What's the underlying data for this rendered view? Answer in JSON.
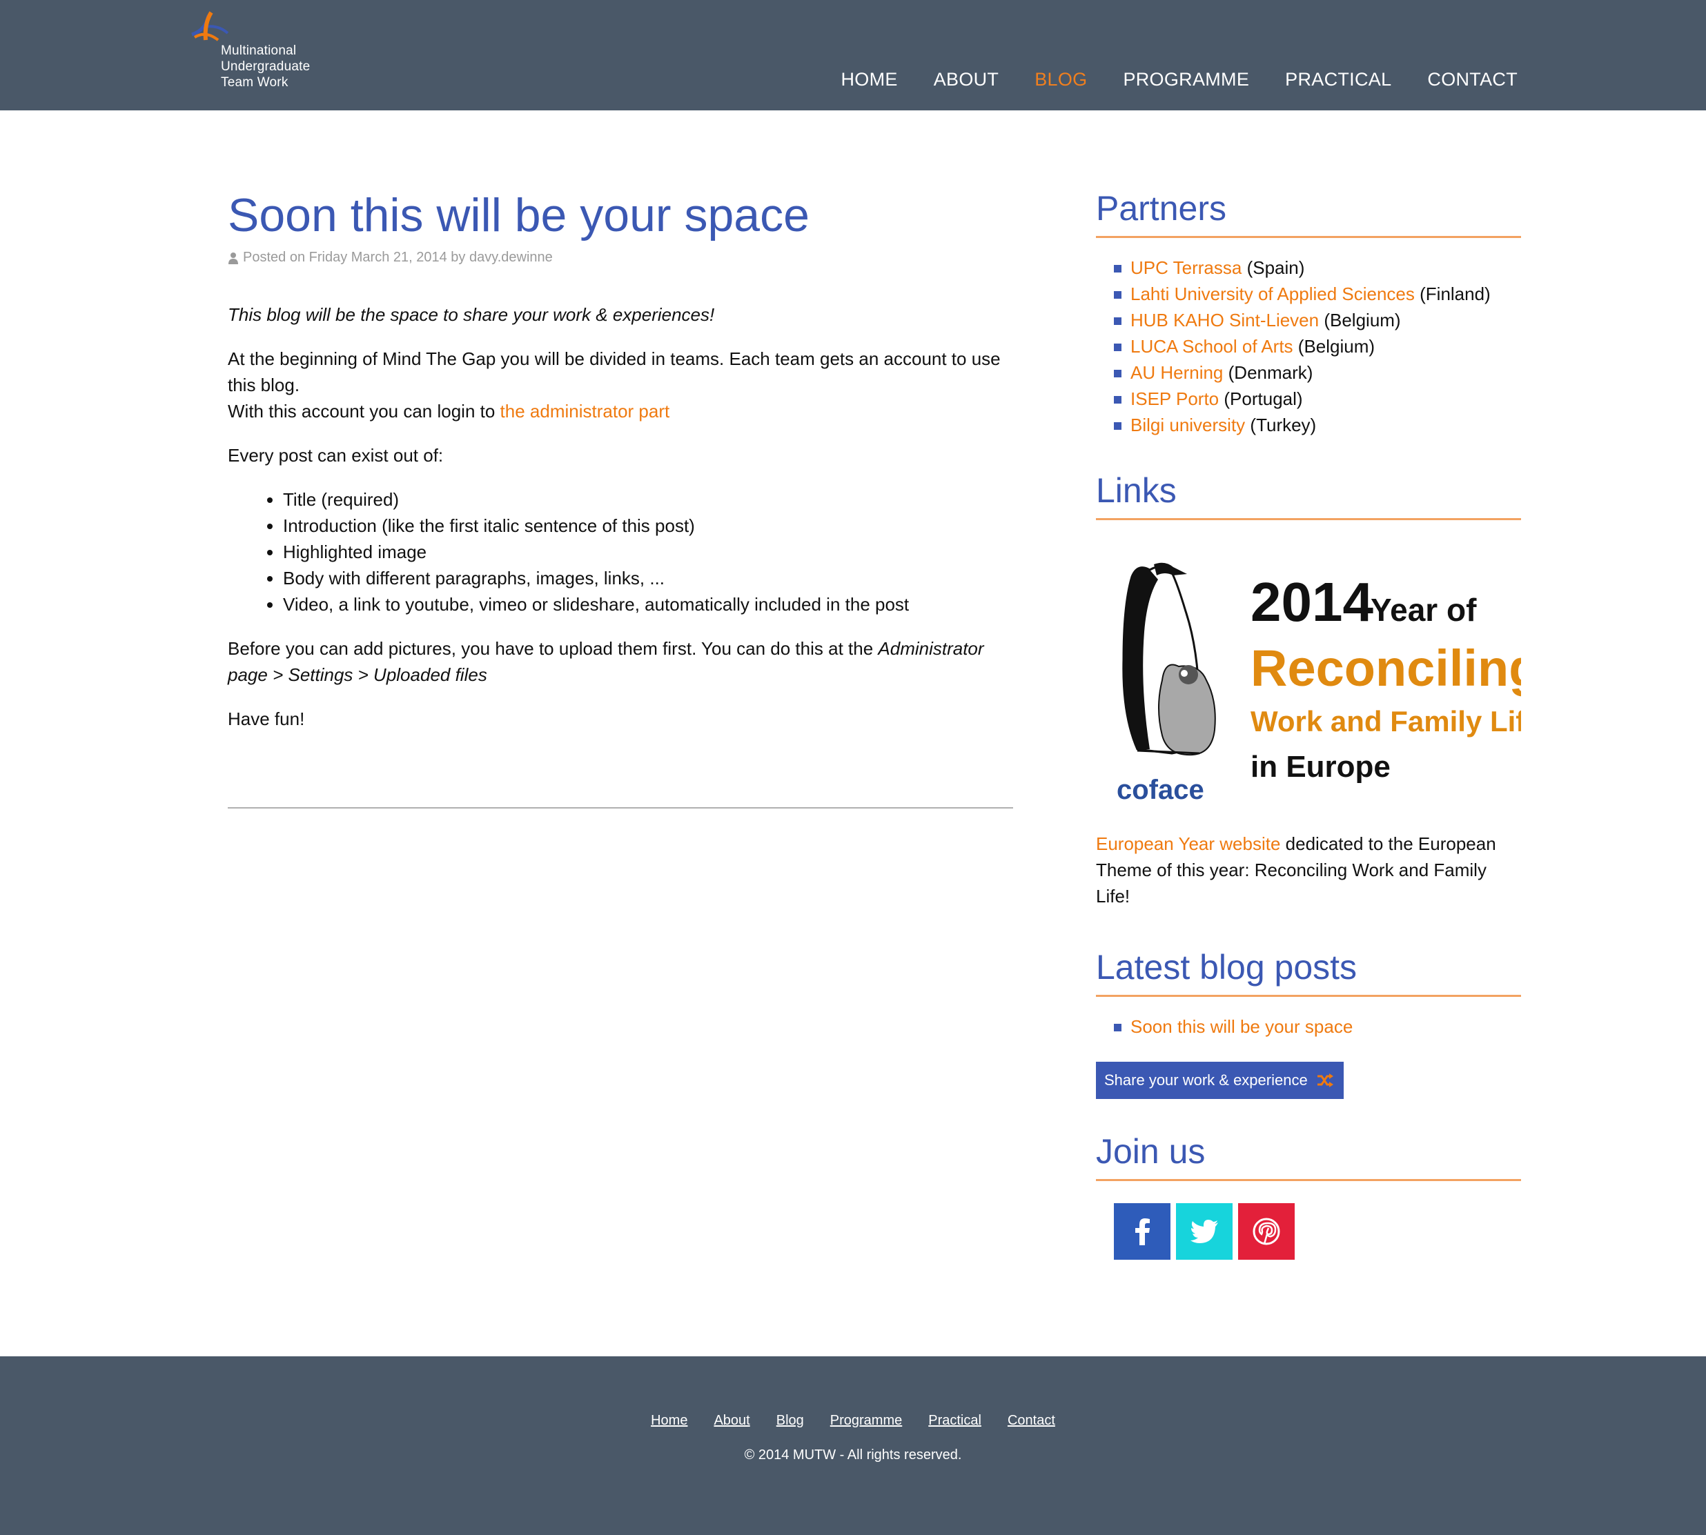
{
  "header": {
    "logo_lines": [
      "Multinational",
      "Undergraduate",
      "Team Work"
    ],
    "nav": [
      "HOME",
      "ABOUT",
      "BLOG",
      "PROGRAMME",
      "PRACTICAL",
      "CONTACT"
    ],
    "active_nav": "BLOG"
  },
  "post": {
    "title": "Soon this will be your space",
    "meta": "Posted on Friday March 21, 2014 by davy.dewinne",
    "intro": "This blog will be the space to share your work & experiences!",
    "p1_line1": "At the beginning of Mind The Gap you will be divided in teams. Each team gets an account to use this blog.",
    "p1_line2": "With this account you can login to ",
    "admin_link": "the administrator part",
    "p2": "Every post can exist out of:",
    "bullets": [
      "Title (required)",
      "Introduction (like the first italic sentence of this post)",
      "Highlighted image",
      "Body with different paragraphs, images, links, ...",
      "Video, a link to youtube, vimeo or slideshare, automatically included in the post"
    ],
    "p3_text": "Before you can add pictures, you have to upload them first. You can do this at the ",
    "p3_em": "Administrator page > Settings > Uploaded files",
    "p4": "Have fun!"
  },
  "sidebar": {
    "partners_heading": "Partners",
    "partners": [
      {
        "name": "UPC Terrassa",
        "country": "(Spain)"
      },
      {
        "name": "Lahti University of Applied Sciences",
        "country": "(Finland)"
      },
      {
        "name": "HUB KAHO Sint-Lieven",
        "country": "(Belgium)"
      },
      {
        "name": "LUCA School of Arts",
        "country": "(Belgium)"
      },
      {
        "name": "AU Herning",
        "country": "(Denmark)"
      },
      {
        "name": "ISEP Porto",
        "country": "(Portugal)"
      },
      {
        "name": "Bilgi university",
        "country": "(Turkey)"
      }
    ],
    "links_heading": "Links",
    "banner": {
      "year": "2014",
      "year_of": "Year of",
      "reconciling": "Reconciling",
      "work_family": "Work and Family Life",
      "in_europe": "in Europe",
      "brand": "coface"
    },
    "ey_link": "European Year website",
    "ey_text": " dedicated to the European Theme of this year: Reconciling Work and Family Life!",
    "latest_heading": "Latest blog posts",
    "latest_posts": [
      "Soon this will be your space"
    ],
    "share_button": "Share your work & experience",
    "join_heading": "Join us",
    "social": [
      "facebook-icon",
      "twitter-icon",
      "pinterest-icon"
    ]
  },
  "footer": {
    "links": [
      "Home",
      "About",
      "Blog",
      "Programme",
      "Practical",
      "Contact"
    ],
    "copyright": "© 2014 MUTW - All rights reserved."
  },
  "colors": {
    "header_bg": "#4a5868",
    "accent_orange": "#ef7a10",
    "heading_blue": "#3b58b3",
    "facebook": "#2e5cba",
    "twitter": "#17d4dc",
    "pinterest": "#e3203a"
  }
}
